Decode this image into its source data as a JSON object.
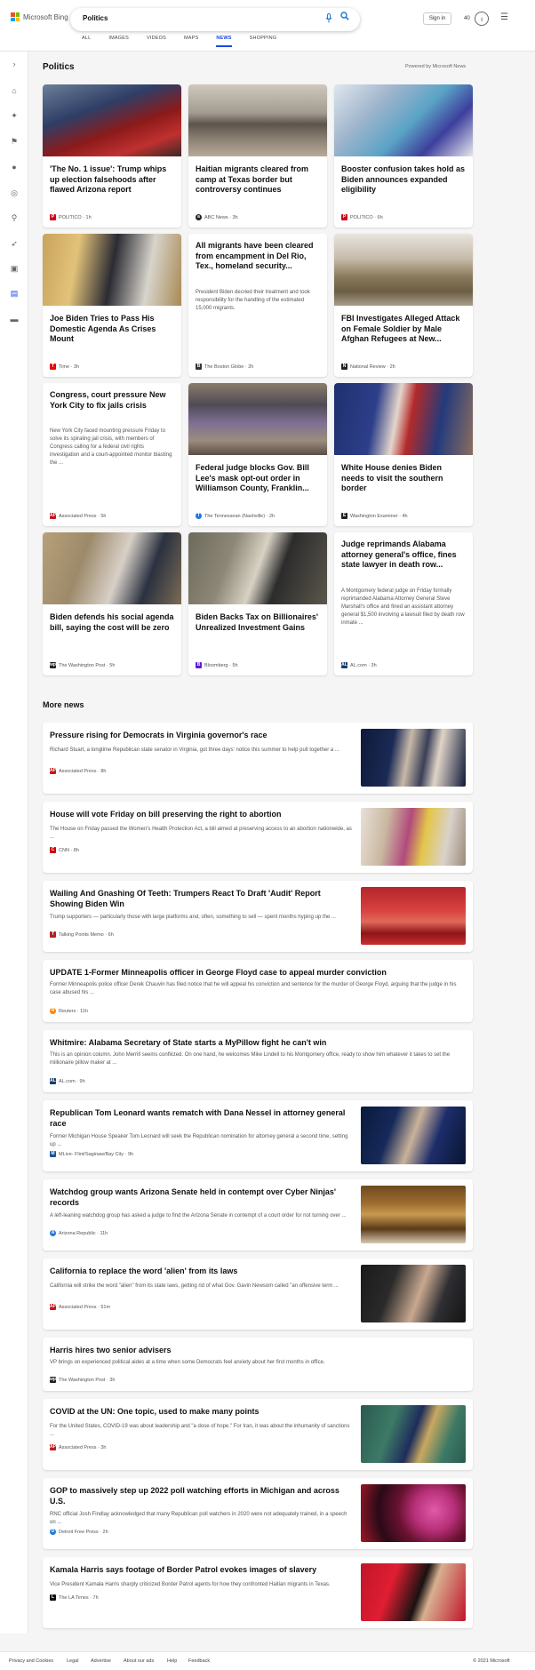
{
  "header": {
    "logo_text": "Microsoft Bing",
    "search_value": "Politics",
    "signin_label": "Sign in",
    "points": "40",
    "tabs": [
      "ALL",
      "IMAGES",
      "VIDEOS",
      "MAPS",
      "NEWS",
      "SHOPPING"
    ],
    "active_tab": "NEWS"
  },
  "section": {
    "title": "Politics",
    "powered_by": "Powered by Microsoft News"
  },
  "cards": [
    {
      "title": "'The No. 1 issue': Trump whips up election falsehoods after flawed Arizona report",
      "source": "POLITICO · 1h",
      "logo_color": "#d0021b"
    },
    {
      "title": "Haitian migrants cleared from camp at Texas border but controversy continues",
      "source": "ABC News · 3h",
      "logo_color": "#222222"
    },
    {
      "title": "Booster confusion takes hold as Biden announces expanded eligibility",
      "source": "POLITICO · 6h",
      "logo_color": "#d0021b"
    },
    {
      "title": "Joe Biden Tries to Pass His Domestic Agenda As Crises Mount",
      "source": "Time · 3h",
      "logo_color": "#e90606"
    },
    {
      "title": "All migrants have been cleared from encampment in Del Rio, Tex., homeland security...",
      "snippet": "President Biden decried their treatment and took responsibility for the handling of the estimated 15,000 migrants.",
      "source": "The Boston Globe · 2h",
      "logo_color": "#333333"
    },
    {
      "title": "FBI Investigates Alleged Attack on Female Soldier by Male Afghan Refugees at New...",
      "source": "National Review · 2h",
      "logo_color": "#222222"
    },
    {
      "title": "Congress, court pressure New York City to fix jails crisis",
      "snippet": "New York City faced mounting pressure Friday to solve its spiraling jail crisis, with members of Congress calling for a federal civil rights investigation and a court-appointed monitor blasting the ...",
      "source": "Associated Press · 5h",
      "logo_color": "#c4161c"
    },
    {
      "title": "Federal judge blocks Gov. Bill Lee's mask opt-out order in Williamson County, Franklin...",
      "source": "The Tennessean (Nashville) · 2h",
      "logo_color": "#1e78d8"
    },
    {
      "title": "White House denies Biden needs to visit the southern border",
      "source": "Washington Examiner · 4h",
      "logo_color": "#222222"
    },
    {
      "title": "Biden defends his social agenda bill, saying the cost will be zero",
      "source": "The Washington Post · 5h",
      "logo_color": "#222222"
    },
    {
      "title": "Biden Backs Tax on Billionaires' Unrealized Investment Gains",
      "source": "Bloomberg · 5h",
      "logo_color": "#5b1dd8"
    },
    {
      "title": "Judge reprimands Alabama attorney general's office, fines state lawyer in death row...",
      "snippet": "A Montgomery federal judge on Friday formally reprimanded Alabama Attorney General Steve Marshall's office and fined an assistant attorney general $1,500 involving a lawsuit filed by death row inmate ...",
      "source": "AL.com · 3h",
      "logo_color": "#1a3a6b"
    }
  ],
  "more_news": {
    "title": "More news",
    "items": [
      {
        "title": "Pressure rising for Democrats in Virginia governor's race",
        "snippet": "Richard Stuart, a longtime Republican state senator in Virginia, got three days' notice this summer to help pull together a ...",
        "source": "Associated Press · 8h",
        "logo_color": "#c4161c"
      },
      {
        "title": "House will vote Friday on bill preserving the right to abortion",
        "snippet": "The House on Friday passed the Women's Health Protection Act, a bill aimed at preserving access to an abortion nationwide, as ...",
        "source": "CNN · 8h",
        "logo_color": "#cc0000"
      },
      {
        "title": "Wailing And Gnashing Of Teeth: Trumpers React To Draft 'Audit' Report Showing Biden Win",
        "snippet": "Trump supporters — particularly those with large platforms and, often, something to sell — spent months hyping up the ...",
        "source": "Talking Points Memo · 6h",
        "logo_color": "#b22222"
      },
      {
        "title": "UPDATE 1-Former Minneapolis officer in George Floyd case to appeal murder conviction",
        "snippet": "Former Minneapolis police officer Derek Chauvin has filed notice that he will appeal his conviction and sentence for the murder of George Floyd, arguing that the judge in his case abused his ...",
        "source": "Reuters · 11h",
        "logo_color": "#ff8000"
      },
      {
        "title": "Whitmire: Alabama Secretary of State starts a MyPillow fight he can't win",
        "snippet": "This is an opinion column. John Merrill seems conflicted. On one hand, he welcomes Mike Lindell to his Montgomery office, ready to show him whatever it takes to set the millionaire pillow maker at ...",
        "source": "AL.com · 9h",
        "logo_color": "#1a3a6b"
      },
      {
        "title": "Republican Tom Leonard wants rematch with Dana Nessel in attorney general race",
        "snippet": "Former Michigan House Speaker Tom Leonard will seek the Republican nomination for attorney general a second time, setting up ...",
        "source": "MLive- Flint/Saginaw/Bay City · 9h",
        "logo_color": "#1e4f9c"
      },
      {
        "title": "Watchdog group wants Arizona Senate held in contempt over Cyber Ninjas' records",
        "snippet": "A left-leaning watchdog group has asked a judge to find the Arizona Senate in contempt of a court order for not turning over ...",
        "source": "Arizona Republic · 11h",
        "logo_color": "#1e78d8"
      },
      {
        "title": "California to replace the word 'alien' from its laws",
        "snippet": "California will strike the word \"alien\" from its state laws, getting rid of what Gov. Gavin Newsom called \"an offensive term ...",
        "source": "Associated Press · 51m",
        "logo_color": "#c4161c"
      },
      {
        "title": "Harris hires two senior advisers",
        "snippet": "VP brings on experienced political aides at a time when some Democrats feel anxiety about her first months in office.",
        "source": "The Washington Post · 3h",
        "logo_color": "#222222"
      },
      {
        "title": "COVID at the UN: One topic, used to make many points",
        "snippet": "For the United States, COVID-19 was about leadership and \"a dose of hope.\" For Iran, it was about the inhumanity of sanctions ...",
        "source": "Associated Press · 3h",
        "logo_color": "#c4161c"
      },
      {
        "title": "GOP to massively step up 2022 poll watching efforts in Michigan and across U.S.",
        "snippet": "RNC official Josh Findlay acknowledged that many Republican poll watchers in 2020 were not adequately trained, in a speech on ...",
        "source": "Detroit Free Press · 2h",
        "logo_color": "#1e78d8"
      },
      {
        "title": "Kamala Harris says footage of Border Patrol evokes images of slavery",
        "snippet": "Vice President Kamala Harris sharply criticized Border Patrol agents for how they confronted Haitian migrants in Texas.",
        "source": "The LA Times · 7h",
        "logo_color": "#111111"
      }
    ]
  },
  "footer": {
    "links": [
      "Privacy and Cookies",
      "Legal",
      "Advertise",
      "About our ads",
      "Help",
      "Feedback"
    ],
    "copyright": "© 2021 Microsoft"
  }
}
